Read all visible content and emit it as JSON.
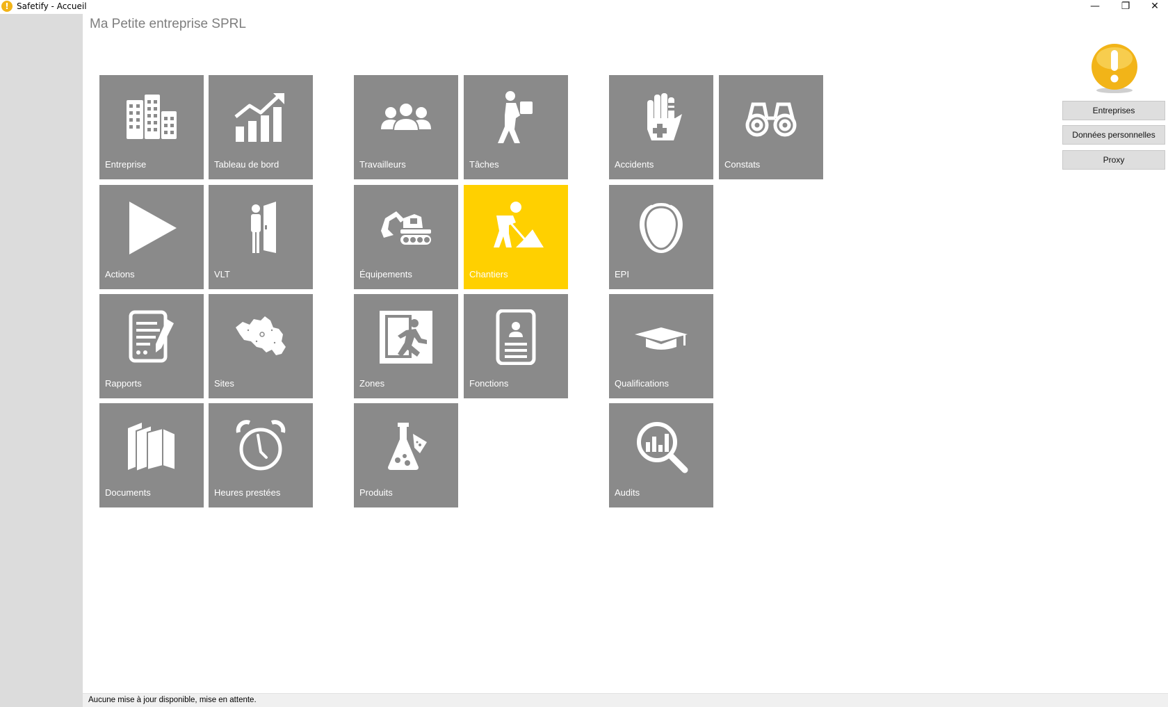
{
  "window": {
    "title": "Safetify - Accueil",
    "minimize_glyph": "—",
    "maximize_glyph": "❐",
    "close_glyph": "✕"
  },
  "company": {
    "name": "Ma Petite entreprise SPRL"
  },
  "tiles": {
    "entreprise": {
      "label": "Entreprise",
      "icon": "buildings-icon"
    },
    "tableau_de_bord": {
      "label": "Tableau de bord",
      "icon": "growth-chart-icon"
    },
    "travailleurs": {
      "label": "Travailleurs",
      "icon": "people-group-icon"
    },
    "taches": {
      "label": "Tâches",
      "icon": "worker-carrying-box-icon"
    },
    "accidents": {
      "label": "Accidents",
      "icon": "bandaged-hand-icon"
    },
    "constats": {
      "label": "Constats",
      "icon": "binoculars-icon"
    },
    "actions": {
      "label": "Actions",
      "icon": "play-icon"
    },
    "vlt": {
      "label": "VLT",
      "icon": "person-at-door-icon"
    },
    "equipements": {
      "label": "Équipements",
      "icon": "excavator-icon"
    },
    "chantiers": {
      "label": "Chantiers",
      "icon": "worker-shoveling-icon",
      "selected": true
    },
    "epi": {
      "label": "EPI",
      "icon": "ear-protection-icon"
    },
    "rapports": {
      "label": "Rapports",
      "icon": "report-pen-icon"
    },
    "sites": {
      "label": "Sites",
      "icon": "map-belgium-icon"
    },
    "zones": {
      "label": "Zones",
      "icon": "emergency-exit-icon"
    },
    "fonctions": {
      "label": "Fonctions",
      "icon": "id-badge-icon"
    },
    "qualifications": {
      "label": "Qualifications",
      "icon": "graduation-cap-icon"
    },
    "documents": {
      "label": "Documents",
      "icon": "books-icon"
    },
    "heures_prestees": {
      "label": "Heures prestées",
      "icon": "alarm-clock-icon"
    },
    "produits": {
      "label": "Produits",
      "icon": "chemical-flask-icon"
    },
    "audits": {
      "label": "Audits",
      "icon": "magnifier-chart-icon"
    }
  },
  "right_panel": {
    "alert_icon": "exclamation-alert-icon",
    "buttons": [
      "Entreprises",
      "Données personnelles",
      "Proxy"
    ]
  },
  "status": {
    "text": "Aucune mise à jour disponible, mise en attente."
  },
  "colors": {
    "tile": "#8a8a8a",
    "tile_selected": "#ffd000",
    "sidebar": "#dcdcdc",
    "alert": "#f2b418"
  }
}
